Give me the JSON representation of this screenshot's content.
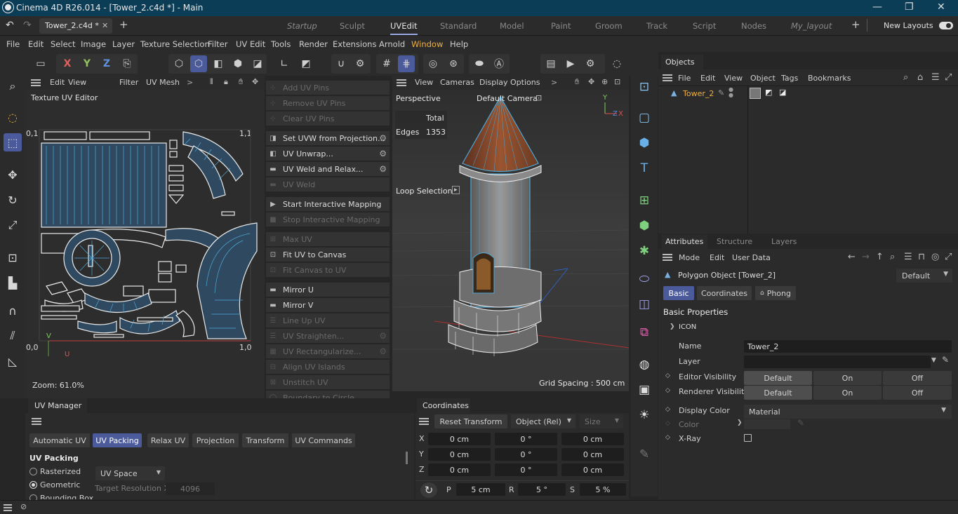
{
  "window": {
    "title": "Cinema 4D R26.014 - [Tower_2.c4d *] - Main",
    "minimize": "—",
    "restore": "❐",
    "close": "✕"
  },
  "doc_tab": {
    "name": "Tower_2.c4d *",
    "close": "✕",
    "add": "+"
  },
  "layouts": {
    "tabs": [
      {
        "label": "Startup",
        "italic": true
      },
      {
        "label": "Sculpt"
      },
      {
        "label": "UVEdit",
        "active": true
      },
      {
        "label": "Standard"
      },
      {
        "label": "Model"
      },
      {
        "label": "Paint"
      },
      {
        "label": "Groom"
      },
      {
        "label": "Track"
      },
      {
        "label": "Script"
      },
      {
        "label": "Nodes"
      },
      {
        "label": "My_layout",
        "italic": true
      }
    ],
    "add": "+",
    "new_layouts": "New Layouts"
  },
  "menu": [
    "File",
    "Edit",
    "Select",
    "Image",
    "Layer",
    "Texture Selection",
    "Filter",
    "UV Edit",
    "Tools",
    "Render",
    "Extensions",
    "Arnold",
    "Window",
    "Help"
  ],
  "toolbar": {
    "axis_x": "X",
    "axis_y": "Y",
    "axis_z": "Z"
  },
  "uv_editor": {
    "menu": [
      "Edit",
      "View",
      "Filter",
      "UV Mesh"
    ],
    "more": ">",
    "title": "Texture UV Editor",
    "corner_tl": "0,1",
    "corner_tr": "1,1",
    "corner_bl": "0,0",
    "corner_br": "1,0",
    "axis_v": "V",
    "axis_u": "U",
    "zoom": "Zoom: 61.0%"
  },
  "commands": [
    {
      "label": "Add UV Pins",
      "disabled": true,
      "icon": "pin"
    },
    {
      "label": "Remove UV Pins",
      "disabled": true,
      "icon": "pin"
    },
    {
      "label": "Clear UV Pins",
      "disabled": true,
      "icon": "pin"
    },
    {
      "label": "Set UVW from Projection...",
      "disabled": false,
      "gear": true,
      "icon": "proj"
    },
    {
      "label": "UV Unwrap...",
      "disabled": false,
      "gear": true,
      "icon": "unwrap"
    },
    {
      "label": "UV Weld and Relax...",
      "disabled": false,
      "gear": true,
      "icon": "weld"
    },
    {
      "label": "UV Weld",
      "disabled": true,
      "icon": "weld"
    },
    {
      "label": "Start Interactive Mapping",
      "disabled": false,
      "icon": "play"
    },
    {
      "label": "Stop Interactive Mapping",
      "disabled": true,
      "icon": "stop"
    },
    {
      "label": "Max UV",
      "disabled": true,
      "icon": "max"
    },
    {
      "label": "Fit UV to Canvas",
      "disabled": false,
      "icon": "fit"
    },
    {
      "label": "Fit Canvas to UV",
      "disabled": true,
      "icon": "fit"
    },
    {
      "label": "Mirror U",
      "disabled": false,
      "icon": "mirror"
    },
    {
      "label": "Mirror V",
      "disabled": false,
      "icon": "mirror"
    },
    {
      "label": "Line Up UV",
      "disabled": true,
      "icon": "line"
    },
    {
      "label": "UV Straighten...",
      "disabled": true,
      "gear": true,
      "icon": "line"
    },
    {
      "label": "UV Rectangularize...",
      "disabled": true,
      "gear": true,
      "icon": "rect"
    },
    {
      "label": "Align UV Islands",
      "disabled": true,
      "icon": "align"
    },
    {
      "label": "Unstitch UV",
      "disabled": true,
      "icon": "unstitch"
    },
    {
      "label": "Boundary to Circle",
      "disabled": true,
      "icon": "circle"
    }
  ],
  "viewport": {
    "menu": [
      "View",
      "Cameras",
      "Display",
      "Options"
    ],
    "more": ">",
    "name": "Perspective",
    "camera": "Default Camera",
    "stats_header": "Total",
    "stats_label": "Edges",
    "stats_value": "1353",
    "tool": "Loop Selection",
    "grid": "Grid Spacing : 500 cm",
    "axis_y": "Y",
    "axis_x": "X",
    "axis_z": "Z"
  },
  "objects": {
    "tab": "Objects",
    "menu": [
      "File",
      "Edit",
      "View",
      "Object",
      "Tags",
      "Bookmarks"
    ],
    "items": [
      {
        "name": "Tower_2"
      }
    ]
  },
  "attributes": {
    "tabs": [
      "Attributes",
      "Structure",
      "Layers"
    ],
    "menu": [
      "Mode",
      "Edit",
      "User Data"
    ],
    "object_title": "Polygon Object [Tower_2]",
    "preset": "Default",
    "subtabs": [
      "Basic",
      "Coordinates",
      "Phong"
    ],
    "section": "Basic Properties",
    "icon_group": "ICON",
    "fields": {
      "name_label": "Name",
      "name_value": "Tower_2",
      "layer_label": "Layer",
      "editor_vis_label": "Editor Visibility",
      "render_vis_label": "Renderer Visibility",
      "vis_options": [
        "Default",
        "On",
        "Off"
      ],
      "display_color_label": "Display Color",
      "display_color_value": "Material",
      "color_label": "Color",
      "xray_label": "X-Ray"
    }
  },
  "uv_manager": {
    "title": "UV Manager",
    "tabs": [
      "Automatic UV",
      "UV Packing",
      "Relax UV",
      "Projection",
      "Transform",
      "UV Commands"
    ],
    "active_tab": "UV Packing",
    "section": "UV Packing",
    "options": [
      "Rasterized",
      "Geometric",
      "Bounding Box"
    ],
    "selected_option": "Geometric",
    "space": "UV Space",
    "target_res_label": "Target Resolution X",
    "target_res_value": "4096"
  },
  "coordinates": {
    "title": "Coordinates",
    "reset": "Reset Transform",
    "mode": "Object (Rel)",
    "size": "Size",
    "rows": [
      {
        "axis": "X",
        "p": "0 cm",
        "r": "0 °",
        "s": "0 cm"
      },
      {
        "axis": "Y",
        "p": "0 cm",
        "r": "0 °",
        "s": "0 cm"
      },
      {
        "axis": "Z",
        "p": "0 cm",
        "r": "0 °",
        "s": "0 cm"
      }
    ],
    "p_label": "P",
    "p_value": "5 cm",
    "r_label": "R",
    "r_value": "5 °",
    "s_label": "S",
    "s_value": "5 %"
  },
  "colors": {
    "accent": "#4a5a9a",
    "titlebar": "#0c3d57",
    "uv_line": "#4fa8d8",
    "roof": "#8a4a2a"
  }
}
